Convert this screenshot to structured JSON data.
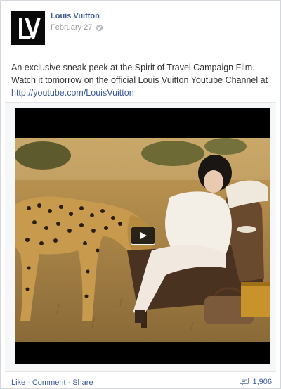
{
  "post": {
    "author": "Louis Vuitton",
    "date": "February 27",
    "message_text": "An exclusive sneak peek at the Spirit of Travel Campaign Film. Watch it tomorrow on the official Louis Vuitton Youtube Channel at ",
    "link_text": "http://youtube.com/LouisVuitton",
    "logo_icon": "lv-monogram-logo",
    "privacy_icon": "globe-icon"
  },
  "video": {
    "thumbnail": "woman-in-armchair-with-cheetah-savanna",
    "play_icon": "play-icon"
  },
  "actions": {
    "like": "Like",
    "comment": "Comment",
    "share": "Share",
    "separator": "·",
    "comment_count": "1,906",
    "comment_icon": "comment-icon"
  },
  "colors": {
    "link": "#3b5998",
    "meta": "#999999",
    "border": "#d3d6db"
  }
}
